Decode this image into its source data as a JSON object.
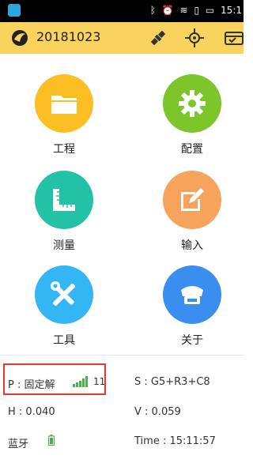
{
  "status_bar": {
    "icons": [
      "bluetooth-icon",
      "alarm-icon",
      "wifi-icon",
      "sim-icon",
      "battery-icon"
    ],
    "time": "15:1"
  },
  "app_bar": {
    "project_name": "20181023",
    "icons": [
      "satellite-icon",
      "crosshair-icon",
      "receiver-icon"
    ]
  },
  "menu": [
    {
      "id": "project",
      "label": "工程",
      "icon": "folder-icon",
      "color": "#fbbf24"
    },
    {
      "id": "config",
      "label": "配置",
      "icon": "gear-icon",
      "color": "#7cc52b"
    },
    {
      "id": "survey",
      "label": "测量",
      "icon": "ruler-icon",
      "color": "#23c2a6"
    },
    {
      "id": "input",
      "label": "输入",
      "icon": "edit-icon",
      "color": "#f6a35c"
    },
    {
      "id": "tools",
      "label": "工具",
      "icon": "tools-icon",
      "color": "#34b6f4"
    },
    {
      "id": "about",
      "label": "关于",
      "icon": "receiver-icon",
      "color": "#3a8ef0"
    }
  ],
  "status": {
    "position_label": "P : 固定解",
    "satellite_count": "11",
    "satellites_label": "S : G5+R3+C8",
    "h_label": "H : 0.040",
    "v_label": "V : 0.059",
    "bluetooth_label": "蓝牙",
    "time_label": "Time : 15:11:57"
  },
  "colors": {
    "app_bar": "#fad25e",
    "signal": "#4caf50",
    "highlight": "#e53935"
  }
}
